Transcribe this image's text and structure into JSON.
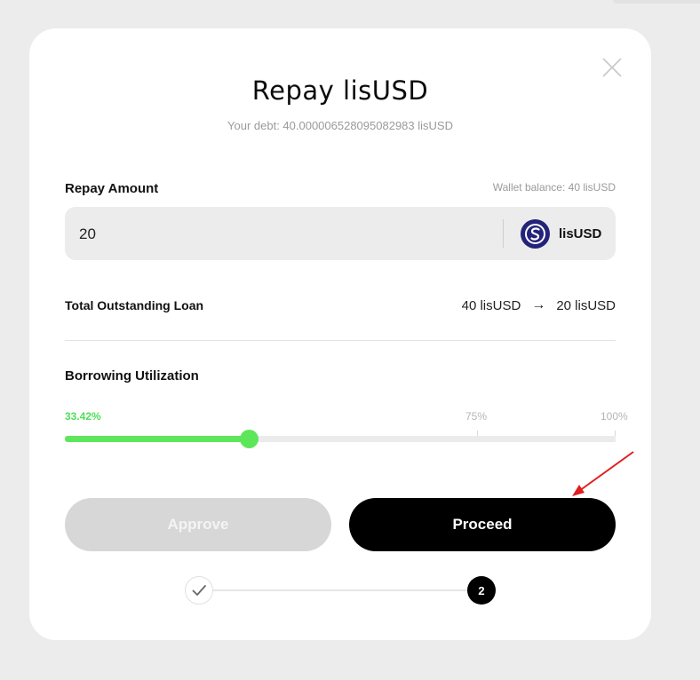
{
  "modal": {
    "title": "Repay lisUSD",
    "subtitle": "Your debt: 40.000006528095082983 lisUSD"
  },
  "repay": {
    "label": "Repay Amount",
    "wallet_balance": "Wallet balance: 40 lisUSD",
    "amount_value": "20",
    "token_name": "lisUSD",
    "token_icon": "lisusd-token-icon"
  },
  "loan": {
    "label": "Total Outstanding Loan",
    "from": "40 lisUSD",
    "arrow": "→",
    "to": "20 lisUSD"
  },
  "utilization": {
    "label": "Borrowing Utilization",
    "current_label": "33.42%",
    "current_value": 0.3342,
    "mark_75": "75%",
    "mark_100": "100%"
  },
  "actions": {
    "approve_label": "Approve",
    "proceed_label": "Proceed"
  },
  "steps": {
    "step1_icon": "check-icon",
    "step2_label": "2"
  },
  "colors": {
    "accent_green": "#5ee65a",
    "primary": "#000000",
    "token_blue": "#23237a",
    "annotation_red": "#e11d1d"
  }
}
